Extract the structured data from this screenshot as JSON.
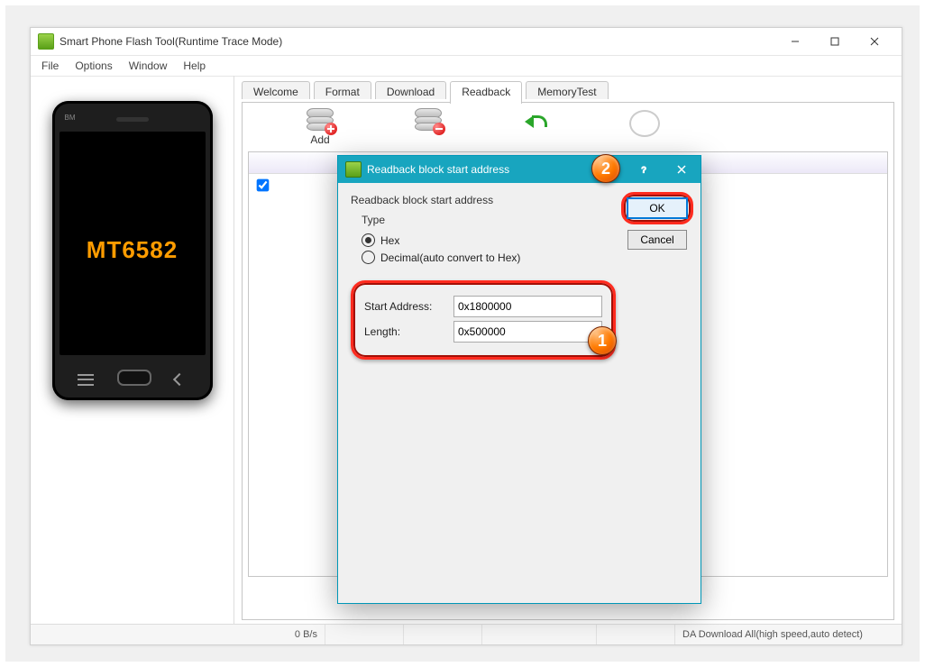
{
  "window": {
    "title": "Smart Phone Flash Tool(Runtime Trace Mode)"
  },
  "menu": {
    "file": "File",
    "options": "Options",
    "window": "Window",
    "help": "Help"
  },
  "phone": {
    "brand": "BM",
    "chip": "MT6582"
  },
  "tabs": {
    "welcome": "Welcome",
    "format": "Format",
    "download": "Download",
    "readback": "Readback",
    "memorytest": "MemoryTest"
  },
  "toolbar": {
    "add": "Add"
  },
  "dialog": {
    "title": "Readback block start address",
    "heading": "Readback block start address",
    "type_label": "Type",
    "hex_label": "Hex",
    "decimal_label": "Decimal(auto convert to Hex)",
    "start_label": "Start Address:",
    "start_value": "0x1800000",
    "length_label": "Length:",
    "length_value": "0x500000",
    "ok": "OK",
    "cancel": "Cancel"
  },
  "callouts": {
    "one": "1",
    "two": "2"
  },
  "status": {
    "bps": "0 B/s",
    "da": "DA Download All(high speed,auto detect)"
  }
}
